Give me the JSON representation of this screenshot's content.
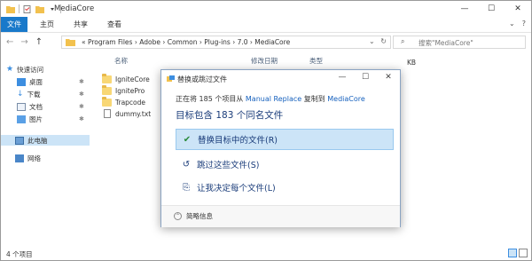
{
  "window": {
    "title": "MediaCore",
    "controls": {
      "minimize": "—",
      "maximize": "☐",
      "close": "✕"
    }
  },
  "ribbon": {
    "tabs": [
      {
        "label": "文件"
      },
      {
        "label": "主页"
      },
      {
        "label": "共享"
      },
      {
        "label": "查看"
      }
    ],
    "help": {
      "collapse": "⌄",
      "help": "?"
    }
  },
  "address": {
    "back": "←",
    "forward": "→",
    "up": "↑",
    "path": "« Program Files › Adobe › Common › Plug-ins › 7.0 › MediaCore",
    "dropdown": "⌄",
    "refresh": "↻",
    "search_placeholder": "搜索\"MediaCore\""
  },
  "sidebar": {
    "items": [
      {
        "label": "快速访问"
      },
      {
        "label": "桌面",
        "pin": "✱"
      },
      {
        "label": "下载",
        "pin": "✱"
      },
      {
        "label": "文档",
        "pin": "✱"
      },
      {
        "label": "图片",
        "pin": "✱"
      },
      {
        "label": "此电脑"
      },
      {
        "label": "网络"
      }
    ]
  },
  "files": {
    "columns": {
      "name": "名称",
      "date": "修改日期",
      "type": "类型"
    },
    "items": [
      {
        "name": "IgniteCore"
      },
      {
        "name": "IgnitePro"
      },
      {
        "name": "Trapcode"
      },
      {
        "name": "dummy.txt"
      }
    ],
    "size_fragment": "KB"
  },
  "status": {
    "count": "4 个项目"
  },
  "dialog": {
    "title": "替换或跳过文件",
    "controls": {
      "minimize": "—",
      "maximize": "☐",
      "close": "✕"
    },
    "line1_prefix": "正在将 185 个项目从",
    "line1_src": "Manual Replace",
    "line1_mid": "复制到",
    "line1_dst": "MediaCore",
    "heading": "目标包含 183 个同名文件",
    "options": [
      {
        "icon": "✔",
        "label": "替换目标中的文件(R)"
      },
      {
        "icon": "↺",
        "label": "跳过这些文件(S)"
      },
      {
        "icon": "⎘",
        "label": "让我决定每个文件(L)"
      }
    ],
    "more_info": "简略信息",
    "more_icon": "⌃"
  },
  "colors": {
    "accent": "#1979ca",
    "selection": "#cce4f7",
    "dialog_text": "#1a3c7a",
    "link": "#1560bd",
    "folder": "#f8d775"
  }
}
